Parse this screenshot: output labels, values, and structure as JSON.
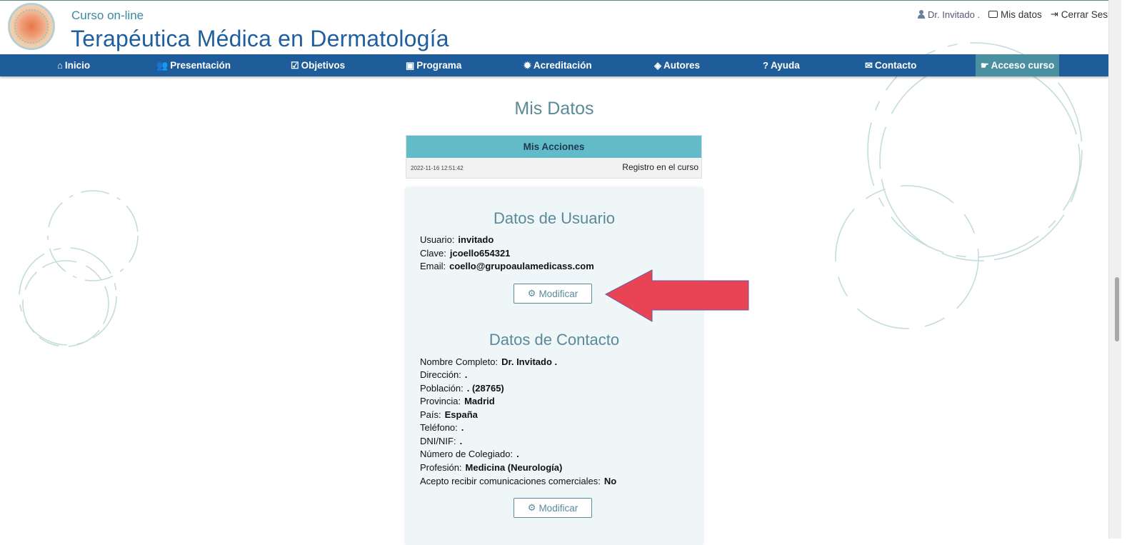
{
  "header": {
    "subtitle": "Curso on-line",
    "title": "Terapéutica Médica en Dermatología",
    "user_name": "Dr. Invitado .",
    "my_data_link": "Mis datos",
    "logout_link": "Cerrar Sesión"
  },
  "nav": {
    "items": [
      {
        "label": "Inicio",
        "icon": "home-icon",
        "glyph": "⌂"
      },
      {
        "label": "Presentación",
        "icon": "users-icon",
        "glyph": "👥"
      },
      {
        "label": "Objetivos",
        "icon": "checkbox-icon",
        "glyph": "☑"
      },
      {
        "label": "Programa",
        "icon": "calendar-check-icon",
        "glyph": "▣"
      },
      {
        "label": "Acreditación",
        "icon": "certificate-icon",
        "glyph": "✹"
      },
      {
        "label": "Autores",
        "icon": "shield-icon",
        "glyph": "◈"
      },
      {
        "label": "Ayuda",
        "icon": "question-icon",
        "glyph": "?"
      },
      {
        "label": "Contacto",
        "icon": "envelope-icon",
        "glyph": "✉"
      },
      {
        "label": "Acceso curso",
        "icon": "hand-pointer-icon",
        "glyph": "☛"
      }
    ],
    "active_index": 8
  },
  "page": {
    "heading": "Mis Datos"
  },
  "actions": {
    "header": "Mis Acciones",
    "rows": [
      {
        "date": "2022-11-16 12:51:42",
        "description": "Registro en el curso"
      }
    ]
  },
  "user_data": {
    "title": "Datos de Usuario",
    "fields": [
      {
        "label": "Usuario:",
        "value": "invitado"
      },
      {
        "label": "Clave:",
        "value": "jcoello654321"
      },
      {
        "label": "Email:",
        "value": "coello@grupoaulamedicass.com"
      }
    ],
    "modify_button": "Modificar"
  },
  "contact_data": {
    "title": "Datos de Contacto",
    "fields": [
      {
        "label": "Nombre Completo:",
        "value": "Dr. Invitado ."
      },
      {
        "label": "Dirección:",
        "value": "."
      },
      {
        "label": "Población:",
        "value": ". (28765)"
      },
      {
        "label": "Provincia:",
        "value": "Madrid"
      },
      {
        "label": "País:",
        "value": "España"
      },
      {
        "label": "Teléfono:",
        "value": "."
      },
      {
        "label": "DNI/NIF:",
        "value": "."
      },
      {
        "label": "Número de Colegiado:",
        "value": "."
      },
      {
        "label": "Profesión:",
        "value": "Medicina (Neurología)"
      },
      {
        "label": "Acepto recibir comunicaciones comerciales:",
        "value": "No"
      }
    ],
    "modify_button": "Modificar"
  },
  "colors": {
    "nav_bg": "#1f5c9a",
    "nav_active": "#4a90a0",
    "title": "#1f5f9f",
    "accent": "#5a8a9a",
    "actions_header": "#62bcc7",
    "arrow": "#e84455"
  }
}
